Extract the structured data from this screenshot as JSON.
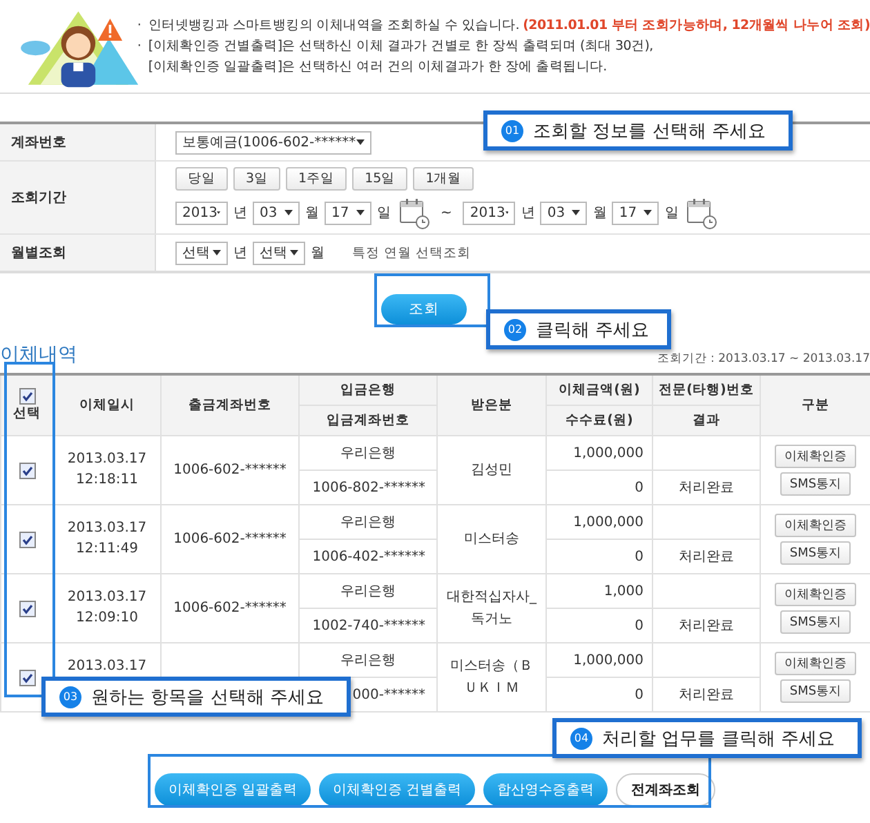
{
  "notice": {
    "lines": [
      {
        "bullet": "·",
        "text": "인터넷뱅킹과 스마트뱅킹의 이체내역을 조회하실 수 있습니다. **(2011.01.01 부터 조회가능하며, 12개월씩 나누어 조회)**"
      },
      {
        "bullet": "·",
        "text": "[이체확인증 건별출력]은 선택하신 이체 결과가 건별로 한 장씩 출력되며 (최대 30건),"
      },
      {
        "text": "[이체확인증 일괄출력]은 선택하신 여러 건의 이체결과가 한 장에 출력됩니다."
      }
    ]
  },
  "form": [
    {
      "kind": "account",
      "label": "계좌번호",
      "value": "보통예금(1006-602-******"
    },
    {
      "kind": "period",
      "label": "조회기간",
      "quick_buttons": [
        "당일",
        "3일",
        "1주일",
        "15일",
        "1개월"
      ],
      "from": [
        {
          "value": "2013",
          "unit": "년"
        },
        {
          "value": "03",
          "unit": "월"
        },
        {
          "value": "17",
          "unit": "일"
        }
      ],
      "separator": "~",
      "to": [
        {
          "value": "2013",
          "unit": "년"
        },
        {
          "value": "03",
          "unit": "월"
        },
        {
          "value": "17",
          "unit": "일"
        }
      ]
    },
    {
      "kind": "monthly",
      "label": "월별조회",
      "selects": [
        {
          "value": "선택",
          "unit": "년"
        },
        {
          "value": "선택",
          "unit": "월"
        }
      ],
      "hint": "특정 연월 선택조회"
    }
  ],
  "search_button": "조회",
  "transfers": {
    "title": "이체내역",
    "period": "조회기간 : 2013.03.17 ~ 2013.03.17",
    "select_label": "선택",
    "all_checked": true,
    "columns": [
      {
        "label": "이체일시"
      },
      {
        "label": "출금계좌번호"
      },
      {
        "label": "입금은행",
        "sub_label": "입금계좌번호"
      },
      {
        "label": "받은분"
      },
      {
        "label": "이체금액(원)",
        "sub_label": "수수료(원)"
      },
      {
        "label": "전문(타행)번호",
        "sub_label": "결과"
      },
      {
        "label": "구분"
      }
    ],
    "rows": [
      {
        "checked": true,
        "date": "2013.03.17",
        "time": "12:18:11",
        "out_account": "1006-602-******",
        "bank": "우리은행",
        "in_account": "1006-802-******",
        "recipient": "김성민",
        "amount": "1,000,000",
        "fee": "0",
        "result": "처리완료",
        "actions": [
          "이체확인증",
          "SMS통지"
        ]
      },
      {
        "checked": true,
        "date": "2013.03.17",
        "time": "12:11:49",
        "out_account": "1006-602-******",
        "bank": "우리은행",
        "in_account": "1006-402-******",
        "recipient": "미스터송",
        "amount": "1,000,000",
        "fee": "0",
        "result": "처리완료",
        "actions": [
          "이체확인증",
          "SMS통지"
        ]
      },
      {
        "checked": true,
        "date": "2013.03.17",
        "time": "12:09:10",
        "out_account": "1006-602-******",
        "bank": "우리은행",
        "in_account": "1002-740-******",
        "recipient": "대한적십자사_독거노",
        "amount": "1,000",
        "fee": "0",
        "result": "처리완료",
        "actions": [
          "이체확인증",
          "SMS통지"
        ]
      },
      {
        "checked": true,
        "date": "2013.03.17",
        "bank": "우리은행",
        "in_account": "000-******",
        "recipient": "미스터송（ＢＵＫＩＭ",
        "amount": "1,000,000",
        "fee": "0",
        "result": "처리완료",
        "actions": [
          "이체확인증",
          "SMS통지"
        ]
      }
    ]
  },
  "actions": [
    {
      "label": "이체확인증 일괄출력",
      "kind": "primary"
    },
    {
      "label": "이체확인증 건별출력",
      "kind": "primary"
    },
    {
      "label": "합산영수증출력",
      "kind": "primary"
    },
    {
      "label": "전계좌조회",
      "kind": "secondary"
    }
  ],
  "callouts": [
    {
      "number": "01",
      "text": "조회할 정보를 선택해 주세요"
    },
    {
      "number": "02",
      "text": "클릭해 주세요"
    },
    {
      "number": "03",
      "text": "원하는 항목을 선택해 주세요"
    },
    {
      "number": "04",
      "text": "처리할 업무를 클릭해 주세요"
    }
  ]
}
